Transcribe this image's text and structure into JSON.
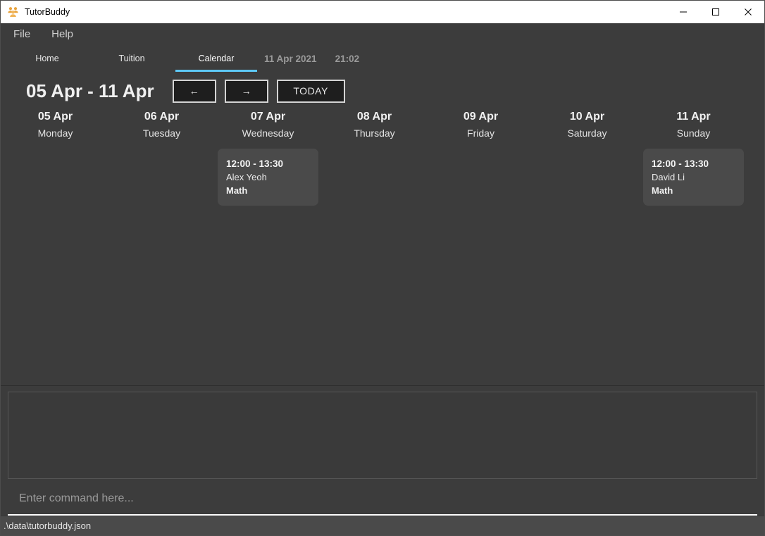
{
  "window": {
    "title": "TutorBuddy",
    "icon": "people-group-icon",
    "controls": {
      "minimize": "minimize-icon",
      "maximize": "maximize-icon",
      "close": "close-icon"
    }
  },
  "menubar": {
    "items": [
      {
        "label": "File"
      },
      {
        "label": "Help"
      }
    ]
  },
  "tabs": {
    "items": [
      {
        "label": "Home",
        "active": false
      },
      {
        "label": "Tuition",
        "active": false
      },
      {
        "label": "Calendar",
        "active": true
      }
    ],
    "date": "11 Apr 2021",
    "time": "21:02",
    "active_underline_color": "#5dc8f5"
  },
  "calendar": {
    "week_range": "05 Apr - 11 Apr",
    "prev_button": "←",
    "next_button": "→",
    "today_button": "TODAY",
    "days": [
      {
        "date": "05 Apr",
        "name": "Monday",
        "events": []
      },
      {
        "date": "06 Apr",
        "name": "Tuesday",
        "events": []
      },
      {
        "date": "07 Apr",
        "name": "Wednesday",
        "events": [
          {
            "time": "12:00 - 13:30",
            "student": "Alex Yeoh",
            "subject": "Math"
          }
        ]
      },
      {
        "date": "08 Apr",
        "name": "Thursday",
        "events": []
      },
      {
        "date": "09 Apr",
        "name": "Friday",
        "events": []
      },
      {
        "date": "10 Apr",
        "name": "Saturday",
        "events": []
      },
      {
        "date": "11 Apr",
        "name": "Sunday",
        "events": [
          {
            "time": "12:00 - 13:30",
            "student": "David Li",
            "subject": "Math"
          }
        ]
      }
    ]
  },
  "result_box": {
    "text": ""
  },
  "command": {
    "value": "",
    "placeholder": "Enter command here..."
  },
  "statusbar": {
    "path": ".\\data\\tutorbuddy.json"
  }
}
